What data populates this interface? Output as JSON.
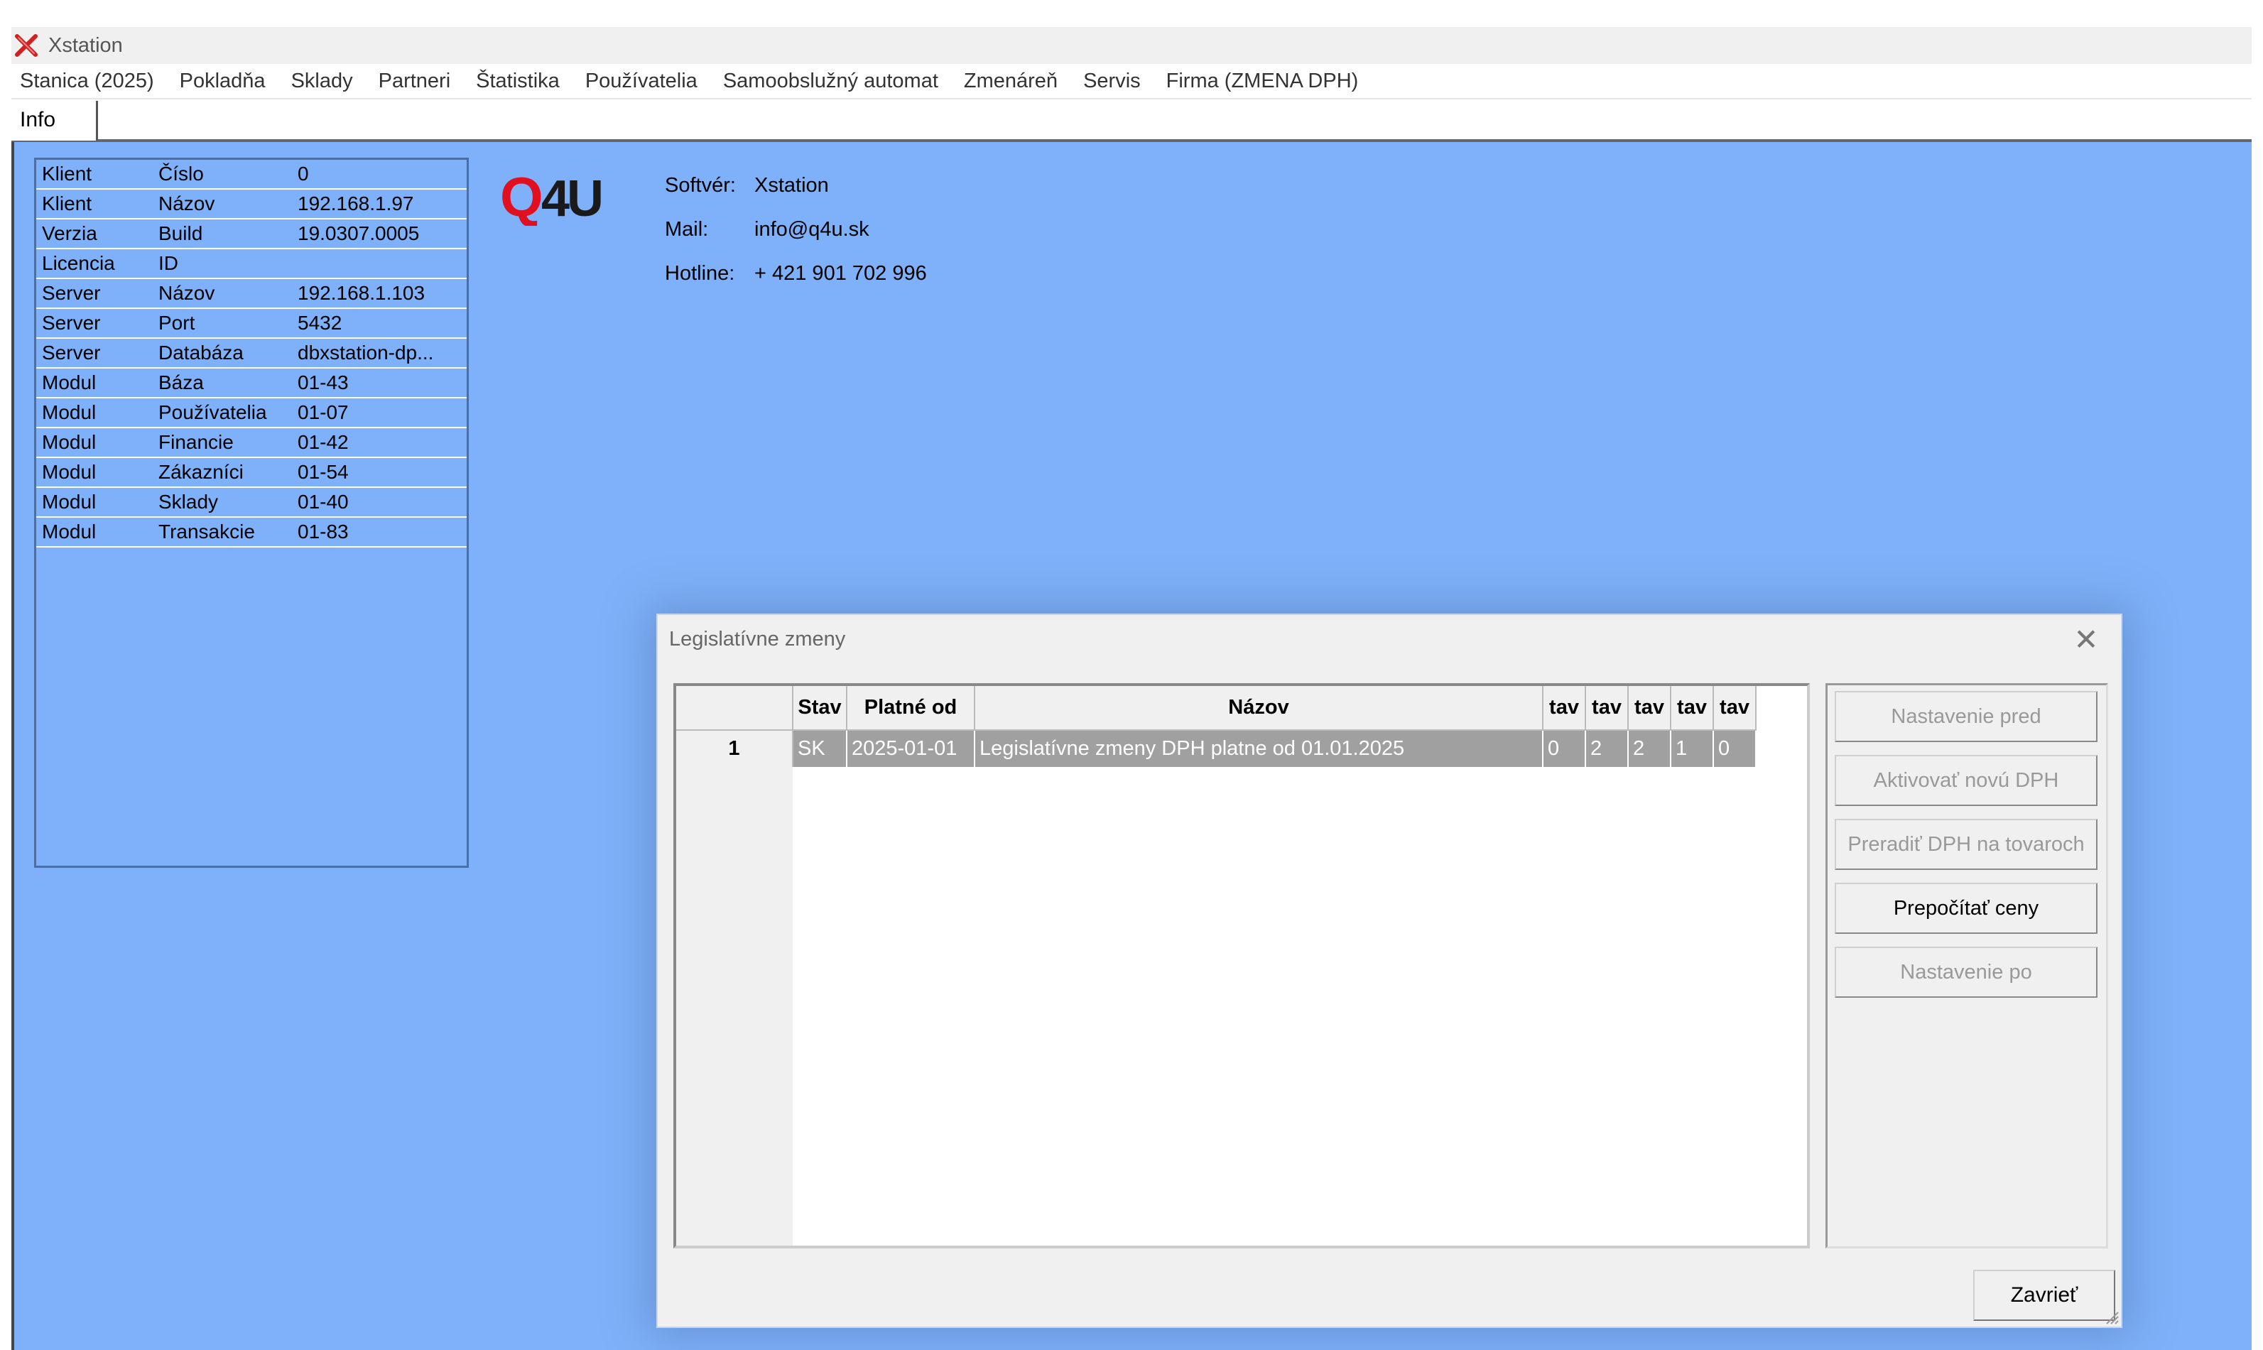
{
  "window": {
    "title": "Xstation",
    "icon": "x-app-icon"
  },
  "menu": [
    "Stanica (2025)",
    "Pokladňa",
    "Sklady",
    "Partneri",
    "Štatistika",
    "Používatelia",
    "Samoobslužný automat",
    "Zmenáreň",
    "Servis",
    "Firma (ZMENA DPH)"
  ],
  "tabs": {
    "info": "Info"
  },
  "info_table": [
    [
      "Klient",
      "Číslo",
      "0"
    ],
    [
      "Klient",
      "Názov",
      "192.168.1.97"
    ],
    [
      "Verzia",
      "Build",
      "19.0307.0005"
    ],
    [
      "Licencia",
      "ID",
      ""
    ],
    [
      "Server",
      "Názov",
      "192.168.1.103"
    ],
    [
      "Server",
      "Port",
      "5432"
    ],
    [
      "Server",
      "Databáza",
      "dbxstation-dp..."
    ],
    [
      "Modul",
      "Báza",
      "01-43"
    ],
    [
      "Modul",
      "Používatelia",
      "01-07"
    ],
    [
      "Modul",
      "Financie",
      "01-42"
    ],
    [
      "Modul",
      "Zákazníci",
      "01-54"
    ],
    [
      "Modul",
      "Sklady",
      "01-40"
    ],
    [
      "Modul",
      "Transakcie",
      "01-83"
    ]
  ],
  "logo": {
    "text": "Q4U",
    "color": "#e01020"
  },
  "software_info": {
    "software_label": "Softvér:",
    "software_value": "Xstation",
    "mail_label": "Mail:",
    "mail_value": "info@q4u.sk",
    "hotline_label": "Hotline:",
    "hotline_value": "+ 421 901 702 996"
  },
  "dialog": {
    "title": "Legislatívne zmeny",
    "columns": [
      "Stav",
      "Platné od",
      "Názov",
      "tav",
      "tav",
      "tav",
      "tav",
      "tav"
    ],
    "rows": [
      {
        "num": "1",
        "cells": [
          "SK",
          "2025-01-01",
          "Legislatívne zmeny DPH platne od 01.01.2025",
          "0",
          "2",
          "2",
          "1",
          "0"
        ]
      }
    ],
    "buttons": {
      "nastavenie_pred": "Nastavenie pred",
      "aktivovat": "Aktivovať novú DPH",
      "preradit": "Preradiť DPH na tovaroch",
      "prepocitat": "Prepočítať ceny",
      "nastavenie_po": "Nastavenie po"
    },
    "close_button": "Zavrieť",
    "close_icon": "close-icon"
  },
  "colors": {
    "background": "#7eb1f9",
    "dialog": "#f0f0f0",
    "selected_row": "#a0a0a0"
  }
}
